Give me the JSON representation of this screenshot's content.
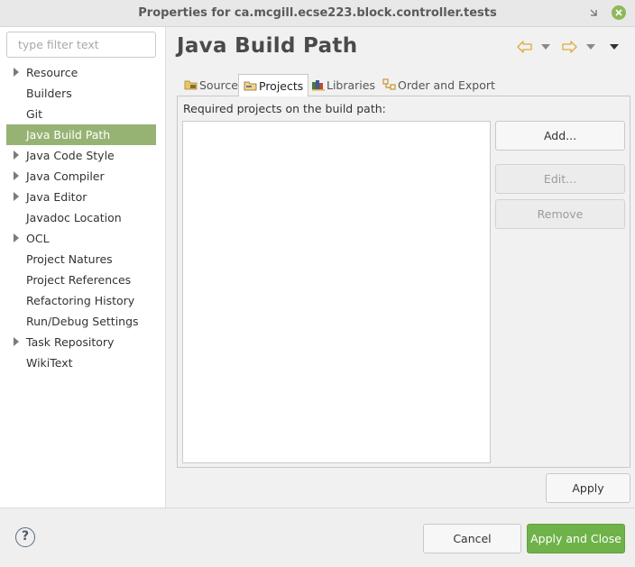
{
  "window": {
    "title": "Properties for ca.mcgill.ecse223.block.controller.tests"
  },
  "filter": {
    "placeholder": "type filter text",
    "value": ""
  },
  "tree": {
    "items": [
      {
        "label": "Resource",
        "expandable": true,
        "selected": false
      },
      {
        "label": "Builders",
        "expandable": false,
        "selected": false
      },
      {
        "label": "Git",
        "expandable": false,
        "selected": false
      },
      {
        "label": "Java Build Path",
        "expandable": false,
        "selected": true
      },
      {
        "label": "Java Code Style",
        "expandable": true,
        "selected": false
      },
      {
        "label": "Java Compiler",
        "expandable": true,
        "selected": false
      },
      {
        "label": "Java Editor",
        "expandable": true,
        "selected": false
      },
      {
        "label": "Javadoc Location",
        "expandable": false,
        "selected": false
      },
      {
        "label": "OCL",
        "expandable": true,
        "selected": false
      },
      {
        "label": "Project Natures",
        "expandable": false,
        "selected": false
      },
      {
        "label": "Project References",
        "expandable": false,
        "selected": false
      },
      {
        "label": "Refactoring History",
        "expandable": false,
        "selected": false
      },
      {
        "label": "Run/Debug Settings",
        "expandable": false,
        "selected": false
      },
      {
        "label": "Task Repository",
        "expandable": true,
        "selected": false
      },
      {
        "label": "WikiText",
        "expandable": false,
        "selected": false
      }
    ]
  },
  "page": {
    "title": "Java Build Path"
  },
  "tabs": [
    {
      "label": "Source",
      "icon": "source-folder-icon",
      "active": false
    },
    {
      "label": "Projects",
      "icon": "project-folder-icon",
      "active": true
    },
    {
      "label": "Libraries",
      "icon": "libraries-icon",
      "active": false
    },
    {
      "label": "Order and Export",
      "icon": "order-export-icon",
      "active": false
    }
  ],
  "projects_tab": {
    "label": "Required projects on the build path:",
    "projects": [],
    "add_label": "Add...",
    "edit_label": "Edit...",
    "remove_label": "Remove"
  },
  "apply_label": "Apply",
  "footer": {
    "help_symbol": "?",
    "cancel_label": "Cancel",
    "apply_close_label": "Apply and Close"
  },
  "colors": {
    "selection": "#97b374",
    "primary_button": "#6fb249",
    "close_button": "#8fb85a"
  }
}
